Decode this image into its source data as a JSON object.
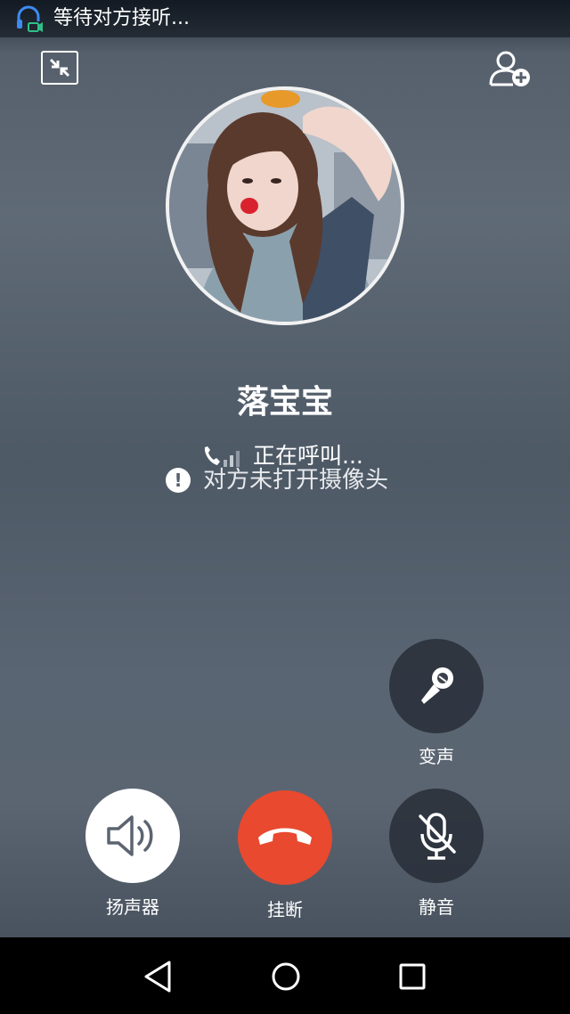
{
  "status_bar": {
    "text": "等待对方接听...",
    "icon": "headset-video-icon"
  },
  "top_controls": {
    "minimize_icon": "minimize-window-icon",
    "add_person_icon": "add-person-icon"
  },
  "contact": {
    "name": "落宝宝",
    "calling_status": "正在呼叫...",
    "camera_notice": "对方未打开摄像头"
  },
  "actions": {
    "voice_changer": {
      "label": "变声",
      "icon": "voice-changer-mic-icon"
    },
    "speaker": {
      "label": "扬声器",
      "icon": "speaker-icon"
    },
    "hangup": {
      "label": "挂断",
      "icon": "phone-hangup-icon",
      "color": "#e8492f"
    },
    "mute": {
      "label": "静音",
      "icon": "mic-muted-icon"
    }
  },
  "navigation": {
    "back_icon": "nav-back-triangle-icon",
    "home_icon": "nav-home-circle-icon",
    "recents_icon": "nav-recents-square-icon"
  }
}
